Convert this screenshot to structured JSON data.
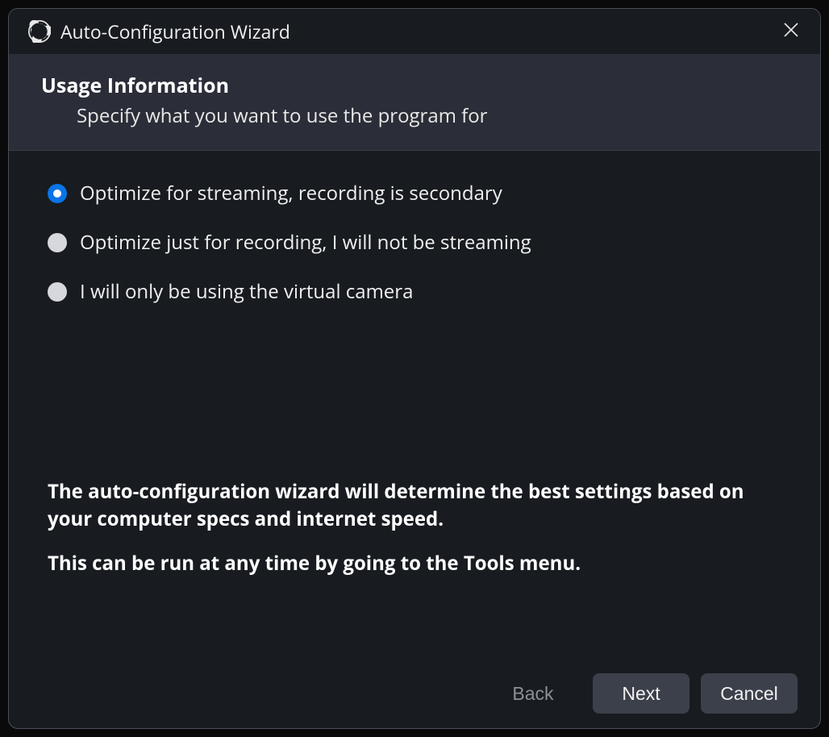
{
  "titlebar": {
    "title": "Auto-Configuration Wizard"
  },
  "header": {
    "heading": "Usage Information",
    "subheading": "Specify what you want to use the program for"
  },
  "options": [
    {
      "label": "Optimize for streaming, recording is secondary",
      "selected": true
    },
    {
      "label": "Optimize just for recording, I will not be streaming",
      "selected": false
    },
    {
      "label": "I will only be using the virtual camera",
      "selected": false
    }
  ],
  "info": {
    "line1": "The auto-configuration wizard will determine the best settings based on your computer specs and internet speed.",
    "line2": "This can be run at any time by going to the Tools menu."
  },
  "footer": {
    "back": "Back",
    "next": "Next",
    "cancel": "Cancel"
  }
}
